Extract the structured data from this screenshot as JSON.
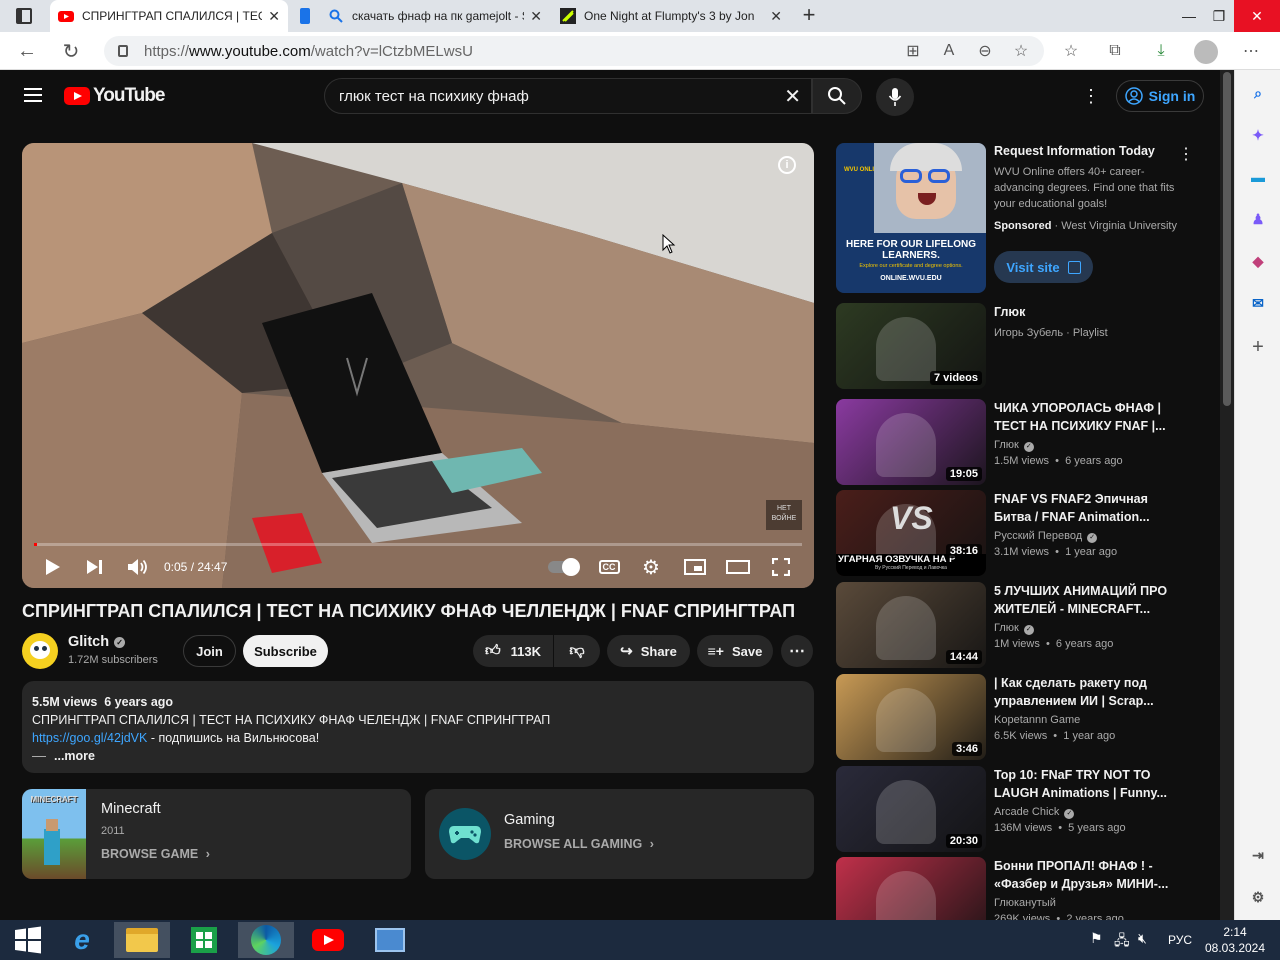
{
  "browser": {
    "tabs": [
      {
        "title": "СПРИНГТРАП СПАЛИЛСЯ | ТЕСТ"
      },
      {
        "title": "скачать фнаф на пк gamejolt - S"
      },
      {
        "title": "One Night at Flumpty's 3 by Jon"
      }
    ],
    "url_prefix": "https://",
    "url_domain": "www.youtube.com",
    "url_path": "/watch?v=lCtzbMELwsU"
  },
  "youtube": {
    "logo_text": "YouTube",
    "search_query": "глюк тест на психику фнаф",
    "sign_in": "Sign in"
  },
  "player": {
    "time": "0:05 / 24:47",
    "progress": 0.0034,
    "watermark_line1": "НЕТ",
    "watermark_line2": "ВОЙНЕ",
    "cc_label": "CC"
  },
  "video": {
    "title": "СПРИНГТРАП СПАЛИЛСЯ | ТЕСТ НА ПСИХИКУ ФНАФ ЧЕЛЛЕНДЖ | FNAF СПРИНГТРАП",
    "channel": "Glitch",
    "subscribers": "1.72M subscribers",
    "join": "Join",
    "subscribe": "Subscribe",
    "likes": "113K",
    "share": "Share",
    "save": "Save"
  },
  "description": {
    "meta": "5.5M views  6 years ago",
    "line1": "СПРИНГТРАП СПАЛИЛСЯ | ТЕСТ НА ПСИХИКУ ФНАФ ЧЕЛЕНДЖ | FNAF СПРИНГТРАП",
    "link": "https://goo.gl/42jdVK",
    "link_suffix": " - подпишись на Вильнюсова!",
    "more": "...more"
  },
  "cards": {
    "game_title": "Minecraft",
    "game_year": "2011",
    "game_action": "BROWSE GAME",
    "gaming_title": "Gaming",
    "gaming_action": "BROWSE ALL GAMING"
  },
  "ad": {
    "title": "Request Information Today",
    "body": "WVU Online offers 40+ career-advancing degrees. Find one that fits your educational goals!",
    "sponsored": "Sponsored",
    "advertiser": "West Virginia University",
    "cta": "Visit site",
    "thumb_headline": "HERE FOR OUR LIFELONG LEARNERS.",
    "thumb_sub": "Explore our certificate and degree options.",
    "thumb_url": "ONLINE.WVU.EDU",
    "thumb_brand": "WVU ONLINE"
  },
  "recommendations": [
    {
      "title": "Глюк",
      "channel": "Игорь Зубель · Playlist",
      "views": "",
      "badge": "7 videos",
      "color": "#2d3a22"
    },
    {
      "title": "ЧИКА УПОРОЛАСЬ ФНАФ | ТЕСТ НА ПСИХИКУ FNAF |...",
      "channel": "Глюк",
      "views": "1.5M views  •  6 years ago",
      "badge": "19:05",
      "color": "#8a3aa0"
    },
    {
      "title": "FNAF VS FNAF2 Эпичная Битва / FNAF Animation...",
      "channel": "Русский Перевод",
      "views": "3.1M views  •  1 year ago",
      "badge": "38:16",
      "color": "#4a1e1a"
    },
    {
      "title": "5 ЛУЧШИХ АНИМАЦИЙ ПРО ЖИТЕЛЕЙ - MINECRAFT...",
      "channel": "Глюк",
      "views": "1M views  •  6 years ago",
      "badge": "14:44",
      "color": "#5a4a3a"
    },
    {
      "title": "| Как сделать ракету под управлением ИИ | Scrap...",
      "channel": "Kopetannn Game",
      "views": "6.5K views  •  1 year ago",
      "badge": "3:46",
      "color": "#c89a55"
    },
    {
      "title": "Top 10: FNaF TRY NOT TO LAUGH Animations | Funny...",
      "channel": "Arcade Chick",
      "views": "136M views  •  5 years ago",
      "badge": "20:30",
      "color": "#2a2a3a"
    },
    {
      "title": "Бонни ПРОПАЛ! ФНАФ ! - «Фазбер и Друзья» МИНИ-...",
      "channel": "Глюканутый",
      "views": "269K views  •  2 years ago",
      "badge": "",
      "color": "#c0304a"
    }
  ],
  "thumb_captions": {
    "fnaf_vs": "VS",
    "fnaf_banner": "УГАРНАЯ ОЗВУЧКА НА Р",
    "fnaf_banner_sub": "By Русский Перевод и Лавочка",
    "minecraft_logo": "MINECRAFT"
  },
  "taskbar": {
    "lang": "РУС",
    "time": "2:14",
    "date": "08.03.2024"
  }
}
